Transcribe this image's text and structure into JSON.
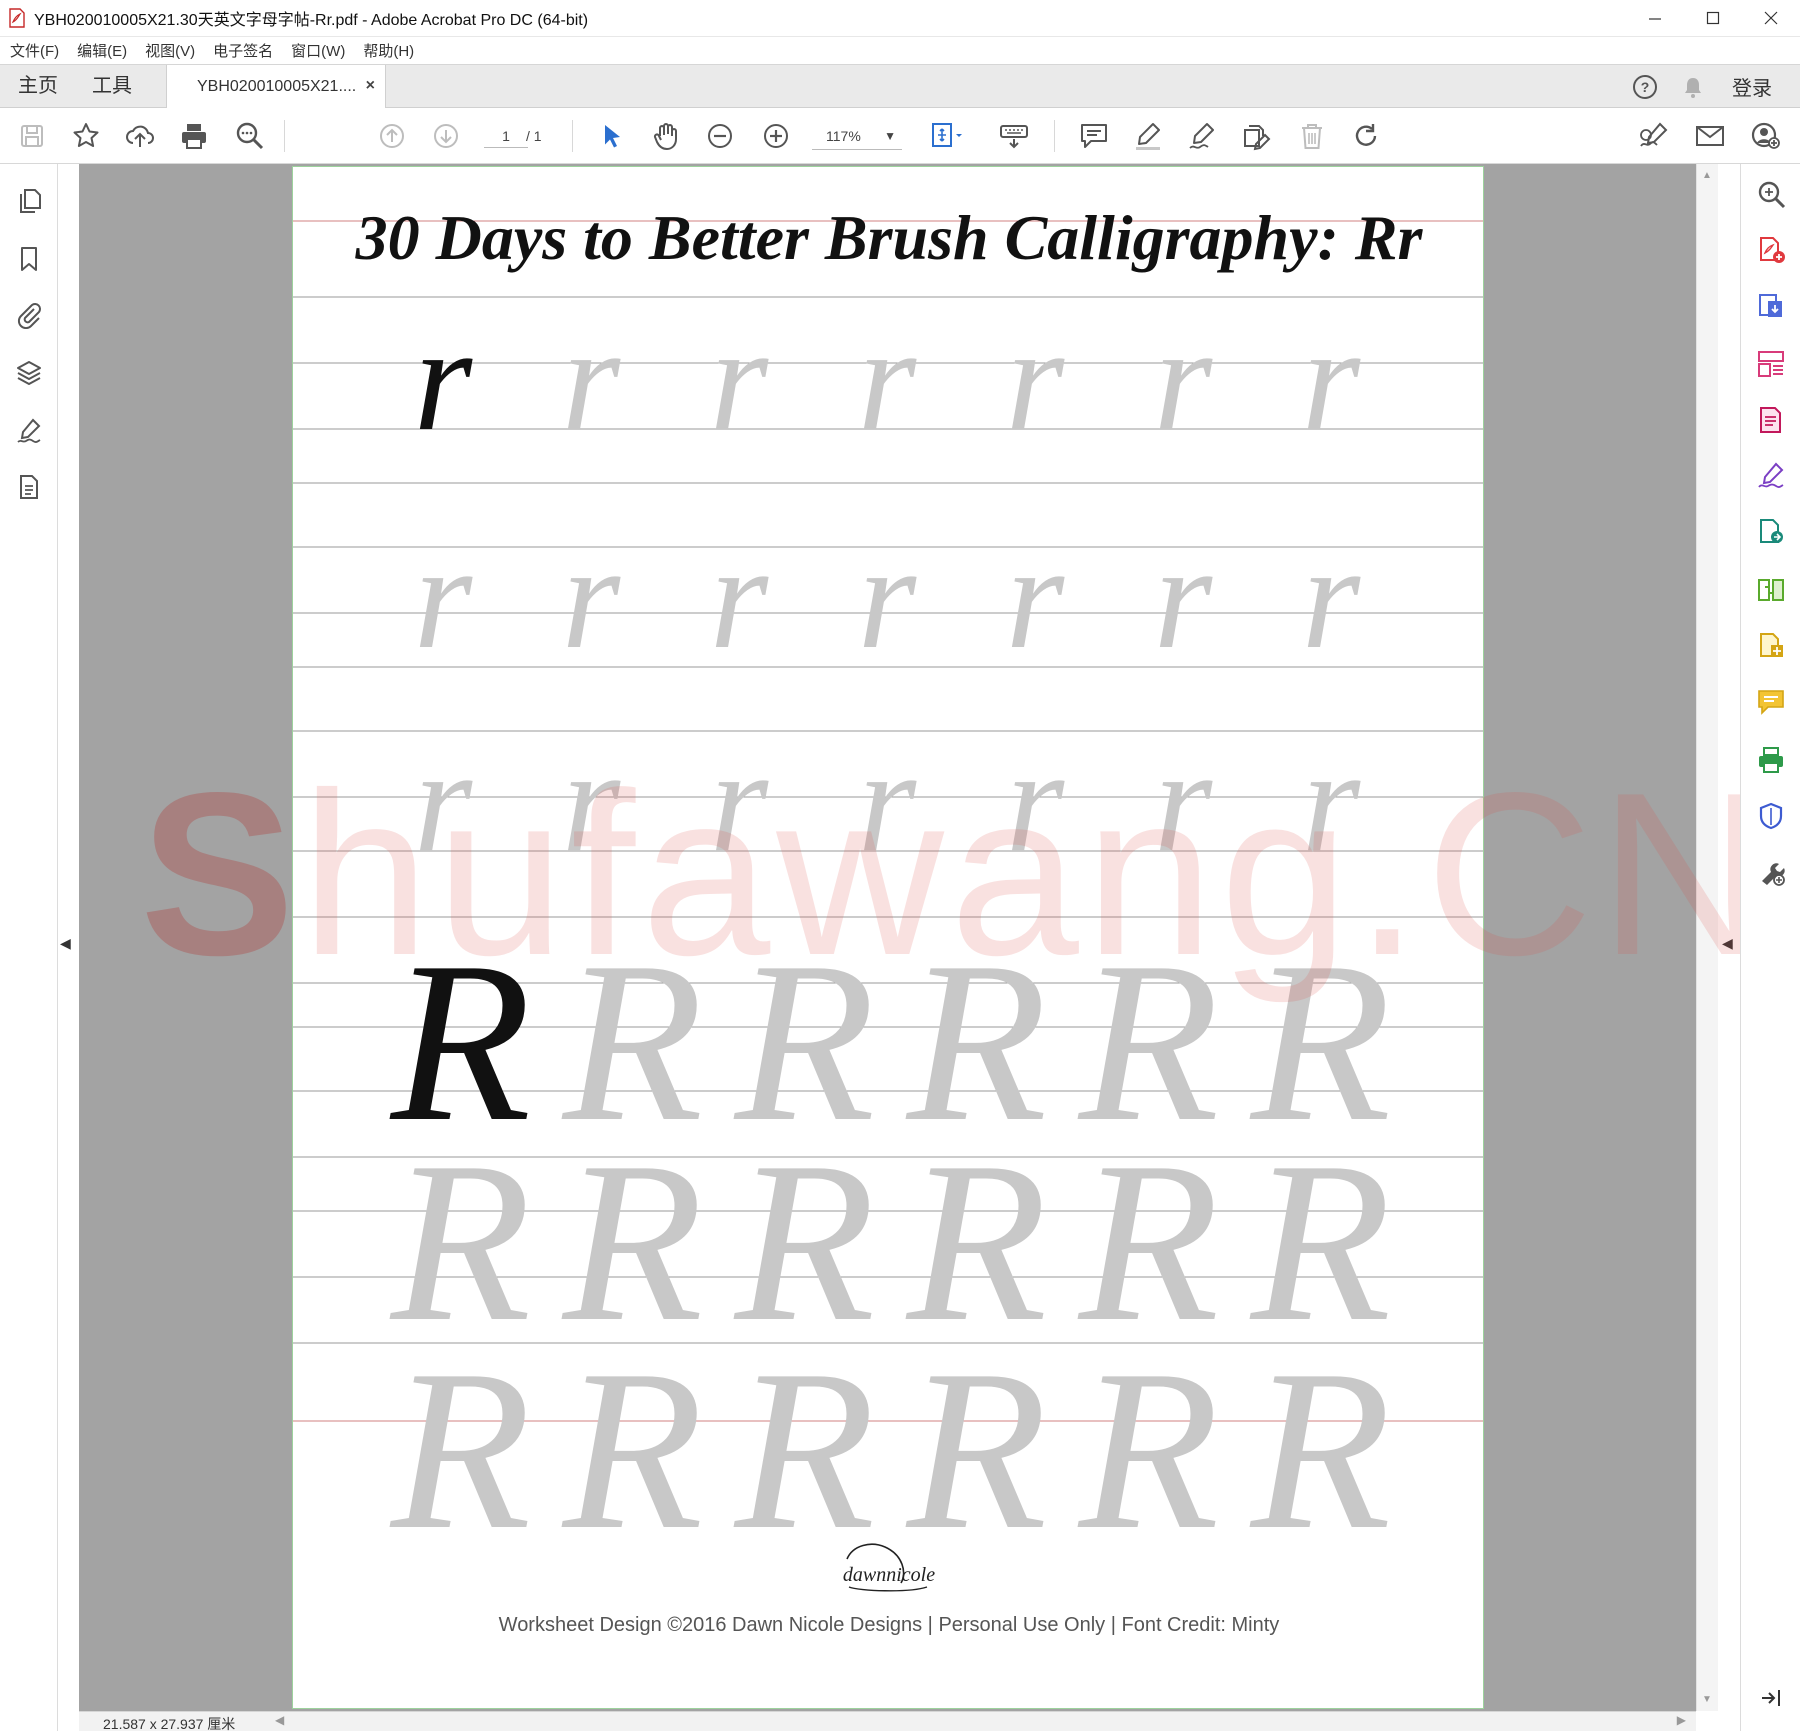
{
  "window": {
    "title": "YBH020010005X21.30天英文字母字帖-Rr.pdf - Adobe Acrobat Pro DC (64-bit)"
  },
  "menu": {
    "items": [
      "文件(F)",
      "编辑(E)",
      "视图(V)",
      "电子签名",
      "窗口(W)",
      "帮助(H)"
    ]
  },
  "tabs": {
    "home": "主页",
    "tools": "工具",
    "document": "YBH020010005X21....",
    "close": "×",
    "login": "登录"
  },
  "toolbar": {
    "page_current": "1",
    "page_total": "/ 1",
    "zoom": "117%"
  },
  "document": {
    "title": "30 Days to Better Brush Calligraphy: Rr",
    "lowercase_letter": "r",
    "uppercase_letter": "R",
    "logo_text": "dawnnicole",
    "footer": "Worksheet Design ©2016 Dawn Nicole Designs | Personal Use Only | Font Credit: Minty",
    "watermark": "Shufawang.CN"
  },
  "status": {
    "page_size": "21.587 x 27.937 厘米"
  },
  "colors": {
    "accent_blue": "#2b6fcf",
    "trace_gray": "#c8c8c8",
    "guide_line": "#9a9a9a",
    "page_border_green": "#9dd29d",
    "watermark_red": "#da5046"
  }
}
